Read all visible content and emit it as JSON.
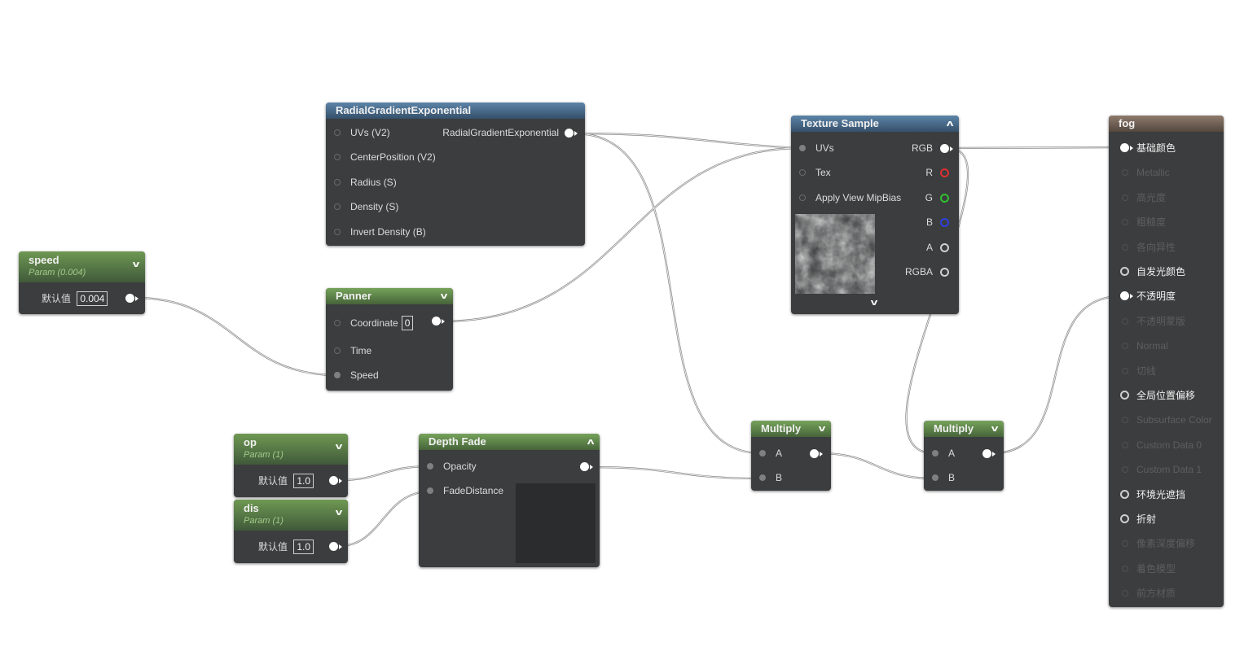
{
  "nodes": {
    "radial": {
      "title": "RadialGradientExponential",
      "inputs": [
        "UVs (V2)",
        "CenterPosition (V2)",
        "Radius (S)",
        "Density (S)",
        "Invert Density (B)"
      ],
      "output": "RadialGradientExponential"
    },
    "speed": {
      "title": "speed",
      "subtitle": "Param (0.004)",
      "label": "默认值",
      "value": "0.004"
    },
    "panner": {
      "title": "Panner",
      "coordinate_label": "Coordinate",
      "coordinate_value": "0",
      "time_label": "Time",
      "speed_label": "Speed"
    },
    "texture": {
      "title": "Texture Sample",
      "inputs": [
        "UVs",
        "Tex",
        "Apply View MipBias"
      ],
      "outputs": [
        "RGB",
        "R",
        "G",
        "B",
        "A",
        "RGBA"
      ]
    },
    "op": {
      "title": "op",
      "subtitle": "Param (1)",
      "label": "默认值",
      "value": "1.0"
    },
    "dis": {
      "title": "dis",
      "subtitle": "Param (1)",
      "label": "默认值",
      "value": "1.0"
    },
    "depth_fade": {
      "title": "Depth Fade",
      "inputs": [
        "Opacity",
        "FadeDistance"
      ]
    },
    "multiply1": {
      "title": "Multiply",
      "inputs": [
        "A",
        "B"
      ]
    },
    "multiply2": {
      "title": "Multiply",
      "inputs": [
        "A",
        "B"
      ]
    },
    "fog": {
      "title": "fog",
      "pins": [
        {
          "label": "基础颜色",
          "state": "connected"
        },
        {
          "label": "Metallic",
          "state": "disabled"
        },
        {
          "label": "高光度",
          "state": "disabled"
        },
        {
          "label": "粗糙度",
          "state": "disabled"
        },
        {
          "label": "各向异性",
          "state": "disabled"
        },
        {
          "label": "自发光颜色",
          "state": "active"
        },
        {
          "label": "不透明度",
          "state": "connected"
        },
        {
          "label": "不透明蒙版",
          "state": "disabled"
        },
        {
          "label": "Normal",
          "state": "disabled"
        },
        {
          "label": "切线",
          "state": "disabled"
        },
        {
          "label": "全局位置偏移",
          "state": "active"
        },
        {
          "label": "Subsurface Color",
          "state": "disabled"
        },
        {
          "label": "Custom Data 0",
          "state": "disabled"
        },
        {
          "label": "Custom Data 1",
          "state": "disabled"
        },
        {
          "label": "环境光遮挡",
          "state": "active"
        },
        {
          "label": "折射",
          "state": "active"
        },
        {
          "label": "像素深度偏移",
          "state": "disabled"
        },
        {
          "label": "着色模型",
          "state": "disabled"
        },
        {
          "label": "前方材质",
          "state": "disabled"
        }
      ]
    }
  },
  "colors": {
    "node_body": "#3b3d3e",
    "header_blue": "#4a6c8c",
    "header_green": "#5e8446",
    "header_brown": "#6f6055",
    "wire": "#c8c8c8",
    "pin_red": "#e03030",
    "pin_green": "#30c030",
    "pin_blue": "#3040e0"
  }
}
